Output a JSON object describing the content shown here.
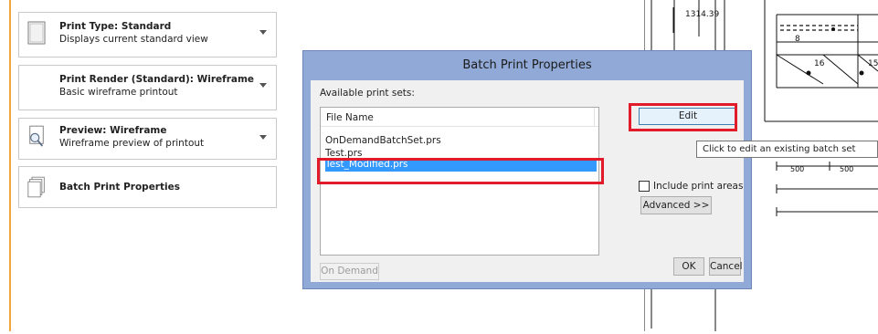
{
  "left_panel": {
    "options": [
      {
        "title": "Print Type: Standard",
        "subtitle": "Displays current standard view",
        "icon": "page-icon"
      },
      {
        "title": "Print Render (Standard): Wireframe",
        "subtitle": "Basic wireframe printout",
        "icon": "render-icon"
      },
      {
        "title": "Preview: Wireframe",
        "subtitle": "Wireframe preview of printout",
        "icon": "magnifier-page-icon"
      },
      {
        "title": "Batch Print Properties",
        "subtitle": "",
        "icon": "stacked-pages-icon"
      }
    ]
  },
  "drawing": {
    "dimension_top": "1314.39",
    "label_8": "8",
    "label_16": "16",
    "label_15": "15",
    "dim_500_a": "500",
    "dim_500_b": "500"
  },
  "dialog": {
    "title": "Batch Print Properties",
    "available_label": "Available print sets:",
    "column_header": "File Name",
    "files": [
      "OnDemandBatchSet.prs",
      "Test.prs",
      "Test_Modified.prs"
    ],
    "selected_index": 2,
    "edit_button": "Edit",
    "tooltip": "Click to edit an existing batch set",
    "include_print_areas": "Include print areas",
    "advanced_button": "Advanced >>",
    "on_demand_button": "On Demand",
    "ok_button": "OK",
    "cancel_button": "Cancel"
  },
  "colors": {
    "accent_orange": "#f2a53a",
    "dialog_frame": "#91a9d6",
    "selection": "#3399ff",
    "highlight_red": "#e21b2a"
  }
}
